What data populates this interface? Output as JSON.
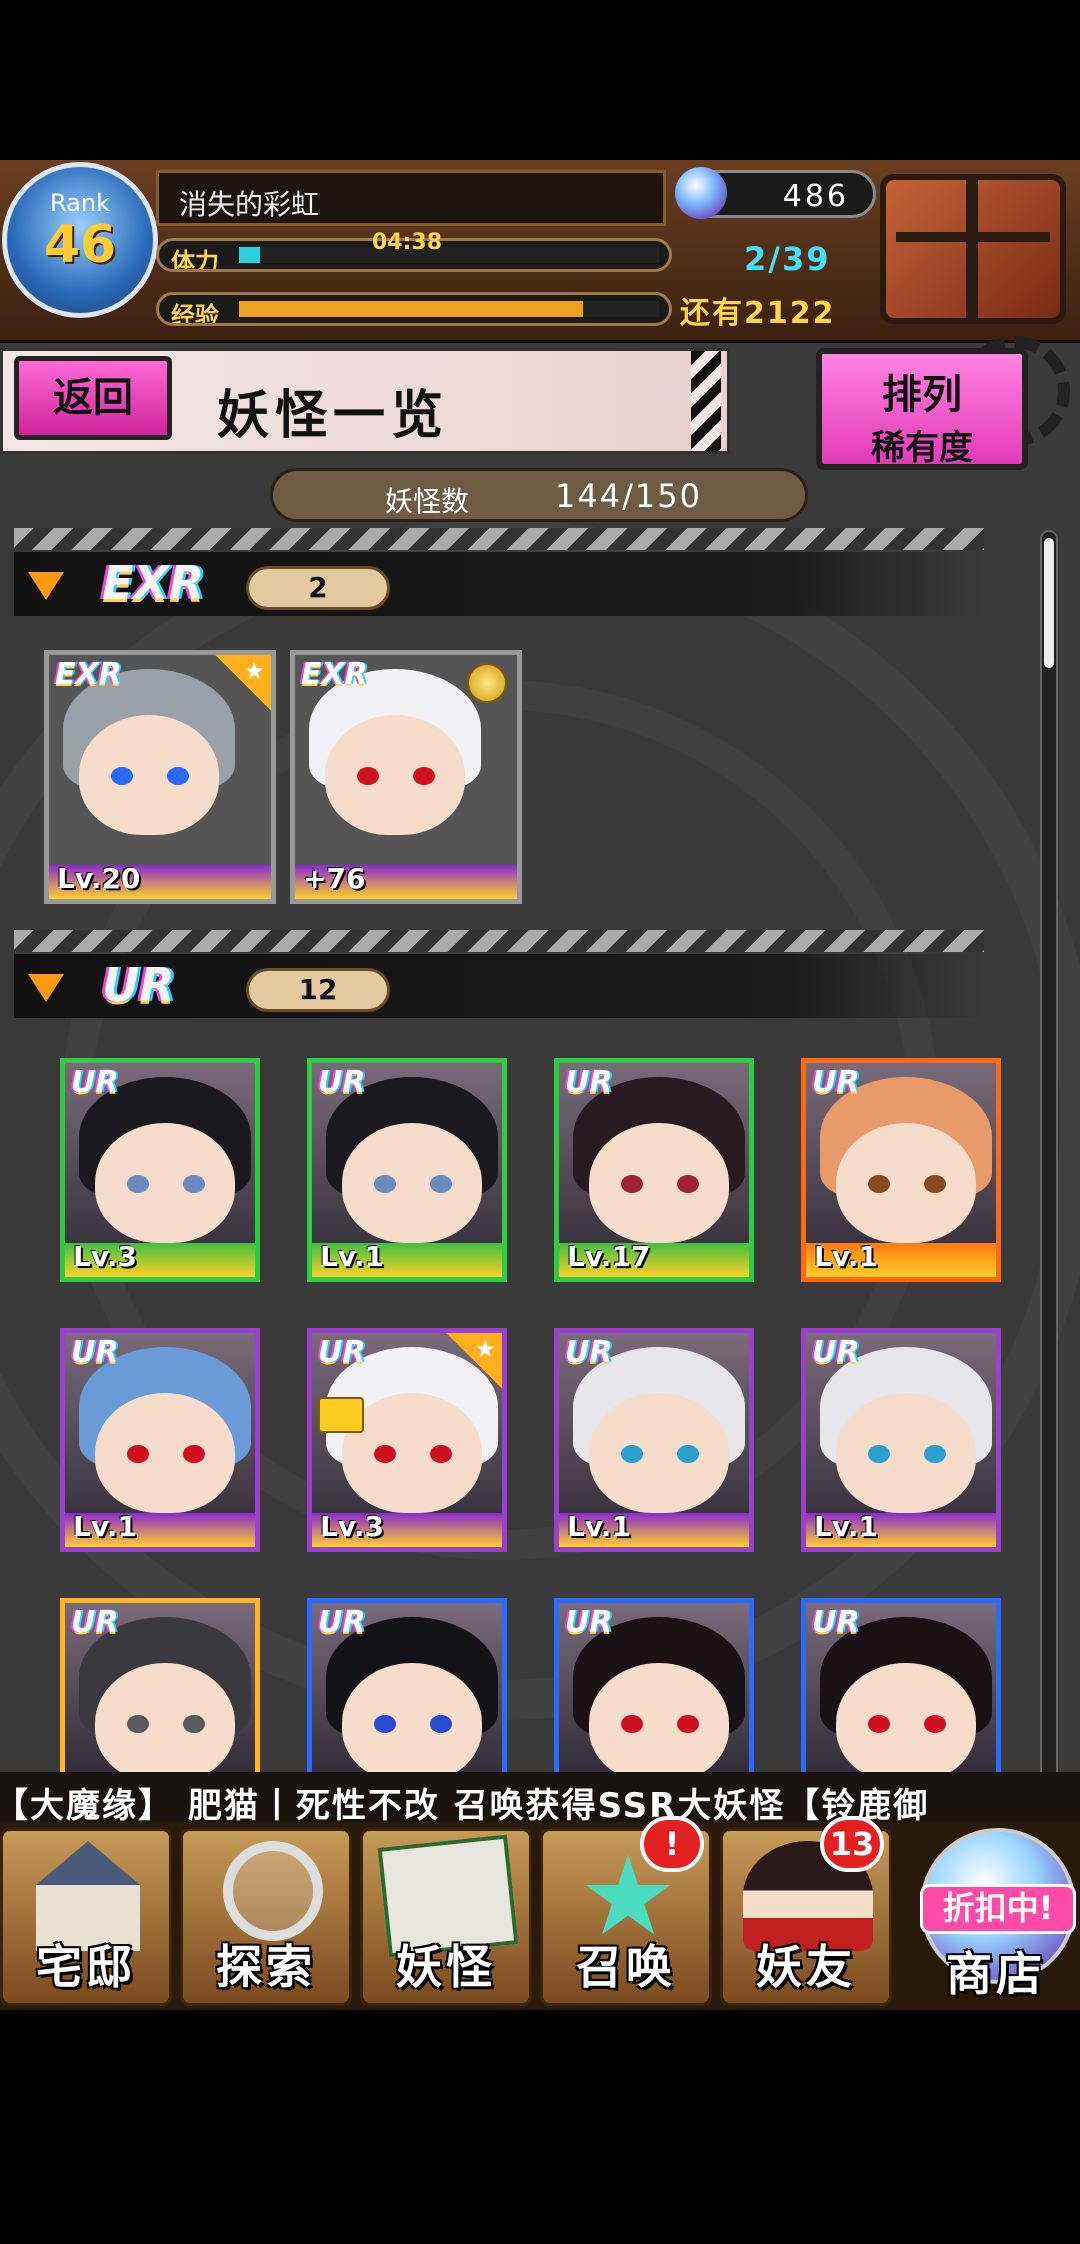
{
  "header": {
    "rank_label": "Rank",
    "rank_value": "46",
    "player_name": "消失的彩虹",
    "stamina_label": "体力",
    "stamina_timer": "04:38",
    "stamina_fraction": 0.05,
    "exp_label": "经验",
    "exp_fraction": 0.82,
    "gems": "486",
    "chest_count": "2/39",
    "exp_remaining": "还有2122"
  },
  "title_row": {
    "back_label": "返回",
    "title": "妖怪一览",
    "sort_label_top": "排列",
    "sort_label_bottom": "稀有度",
    "count_label": "妖怪数",
    "count_value": "144/150"
  },
  "sections": [
    {
      "rarity": "EXR",
      "count": "2",
      "cards": [
        {
          "badge": "EXR",
          "level": "Lv.20",
          "hair": "#9aa0a8",
          "eye": "#2a6aff",
          "frame": "frame",
          "star": true
        },
        {
          "badge": "EXR",
          "level": "+76",
          "hair": "#f2f2f6",
          "eye": "#d01020",
          "frame": "frame",
          "medal": true
        }
      ]
    },
    {
      "rarity": "UR",
      "count": "12",
      "cards": [
        {
          "badge": "UR",
          "level": "Lv.3",
          "hair": "#1a1a1e",
          "eye": "#6a8ac0",
          "frame": "g"
        },
        {
          "badge": "UR",
          "level": "Lv.1",
          "hair": "#1a1a1e",
          "eye": "#6a8ac0",
          "frame": "g"
        },
        {
          "badge": "UR",
          "level": "Lv.17",
          "hair": "#2a1a22",
          "eye": "#a02030",
          "frame": "g"
        },
        {
          "badge": "UR",
          "level": "Lv.1",
          "hair": "#e89a6a",
          "eye": "#8a4a20",
          "frame": "o"
        },
        {
          "badge": "UR",
          "level": "Lv.1",
          "hair": "#6a9ad8",
          "eye": "#d01020",
          "frame": "p"
        },
        {
          "badge": "UR",
          "level": "Lv.3",
          "hair": "#f2f2f6",
          "eye": "#d01020",
          "frame": "p",
          "star": true,
          "lock": true
        },
        {
          "badge": "UR",
          "level": "Lv.1",
          "hair": "#e6e6ea",
          "eye": "#2aa0d0",
          "frame": "p"
        },
        {
          "badge": "UR",
          "level": "Lv.1",
          "hair": "#e6e6ea",
          "eye": "#2aa0d0",
          "frame": "p"
        },
        {
          "badge": "UR",
          "level": "",
          "hair": "#3a3a3e",
          "eye": "#5a5a5a",
          "frame": "y"
        },
        {
          "badge": "UR",
          "level": "",
          "hair": "#141418",
          "eye": "#2a4ad0",
          "frame": "b"
        },
        {
          "badge": "UR",
          "level": "",
          "hair": "#1a1214",
          "eye": "#d01020",
          "frame": "b"
        },
        {
          "badge": "UR",
          "level": "",
          "hair": "#1a1214",
          "eye": "#d01020",
          "frame": "b"
        }
      ]
    }
  ],
  "ticker_text": "【大魔缘】  肥猫丨死性不改 召唤获得SSR大妖怪【铃鹿御",
  "nav": {
    "home": "宅邸",
    "explore": "探索",
    "yokai": "妖怪",
    "summon": "召唤",
    "summon_badge": "!",
    "friends": "妖友",
    "friends_badge": "13",
    "shop": "商店",
    "shop_sale": "折扣中!"
  },
  "colors": {
    "accent_pink": "#e23ab8",
    "stamina_fill": "#2ad0e0",
    "exp_fill": "#f0a020"
  }
}
